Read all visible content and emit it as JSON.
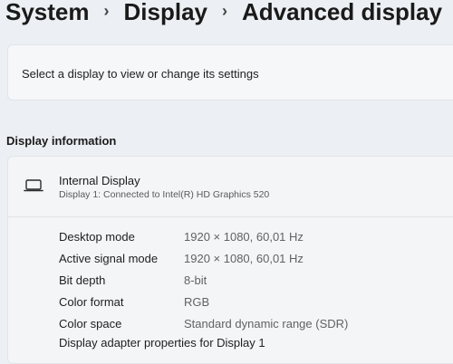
{
  "breadcrumb": {
    "items": [
      "System",
      "Display",
      "Advanced display"
    ],
    "separator": "›"
  },
  "select_display": {
    "label": "Select a display to view or change its settings"
  },
  "display_information": {
    "heading": "Display information",
    "display": {
      "icon": "laptop-icon",
      "name": "Internal Display",
      "description": "Display 1: Connected to Intel(R) HD Graphics 520"
    },
    "properties": [
      {
        "label": "Desktop mode",
        "value": "1920 × 1080, 60,01 Hz"
      },
      {
        "label": "Active signal mode",
        "value": "1920 × 1080, 60,01 Hz"
      },
      {
        "label": "Bit depth",
        "value": "8-bit"
      },
      {
        "label": "Color format",
        "value": "RGB"
      },
      {
        "label": "Color space",
        "value": "Standard dynamic range (SDR)"
      }
    ],
    "adapter_link": "Display adapter properties for Display 1"
  }
}
